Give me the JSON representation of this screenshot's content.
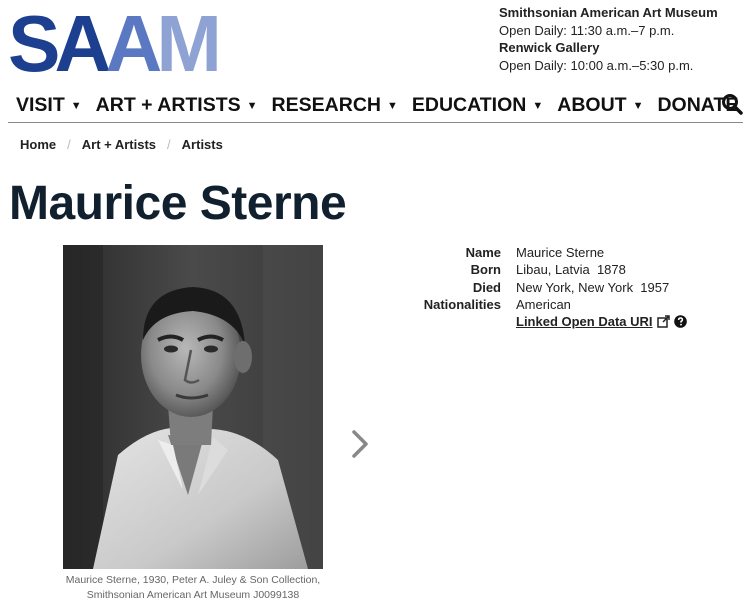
{
  "header": {
    "logo_text": "SAAM",
    "museums": [
      {
        "name": "Smithsonian American Art Museum",
        "hours": "Open Daily: 11:30 a.m.–7 p.m."
      },
      {
        "name": "Renwick Gallery",
        "hours": "Open Daily: 10:00 a.m.–5:30 p.m."
      }
    ]
  },
  "nav": {
    "items": [
      {
        "label": "VISIT"
      },
      {
        "label": "ART + ARTISTS"
      },
      {
        "label": "RESEARCH"
      },
      {
        "label": "EDUCATION"
      },
      {
        "label": "ABOUT"
      },
      {
        "label": "DONATE"
      }
    ],
    "search_icon": "search-icon"
  },
  "breadcrumb": [
    "Home",
    "Art + Artists",
    "Artists"
  ],
  "artist": {
    "name": "Maurice Sterne",
    "image_caption_line1": "Maurice Sterne, 1930, Peter A. Juley & Son Collection,",
    "image_caption_line2": "Smithsonian American Art Museum J0099138",
    "details": [
      {
        "label": "Name",
        "value": "Maurice Sterne"
      },
      {
        "label": "Born",
        "value": "Libau, Latvia  1878"
      },
      {
        "label": "Died",
        "value": "New York, New York  1957"
      },
      {
        "label": "Nationalities",
        "value": "American"
      }
    ],
    "lod_link": "Linked Open Data URI"
  },
  "colors": {
    "logo_dark": "#1d3f8f",
    "logo_light": "#8ea3d3",
    "title": "#10202e"
  }
}
